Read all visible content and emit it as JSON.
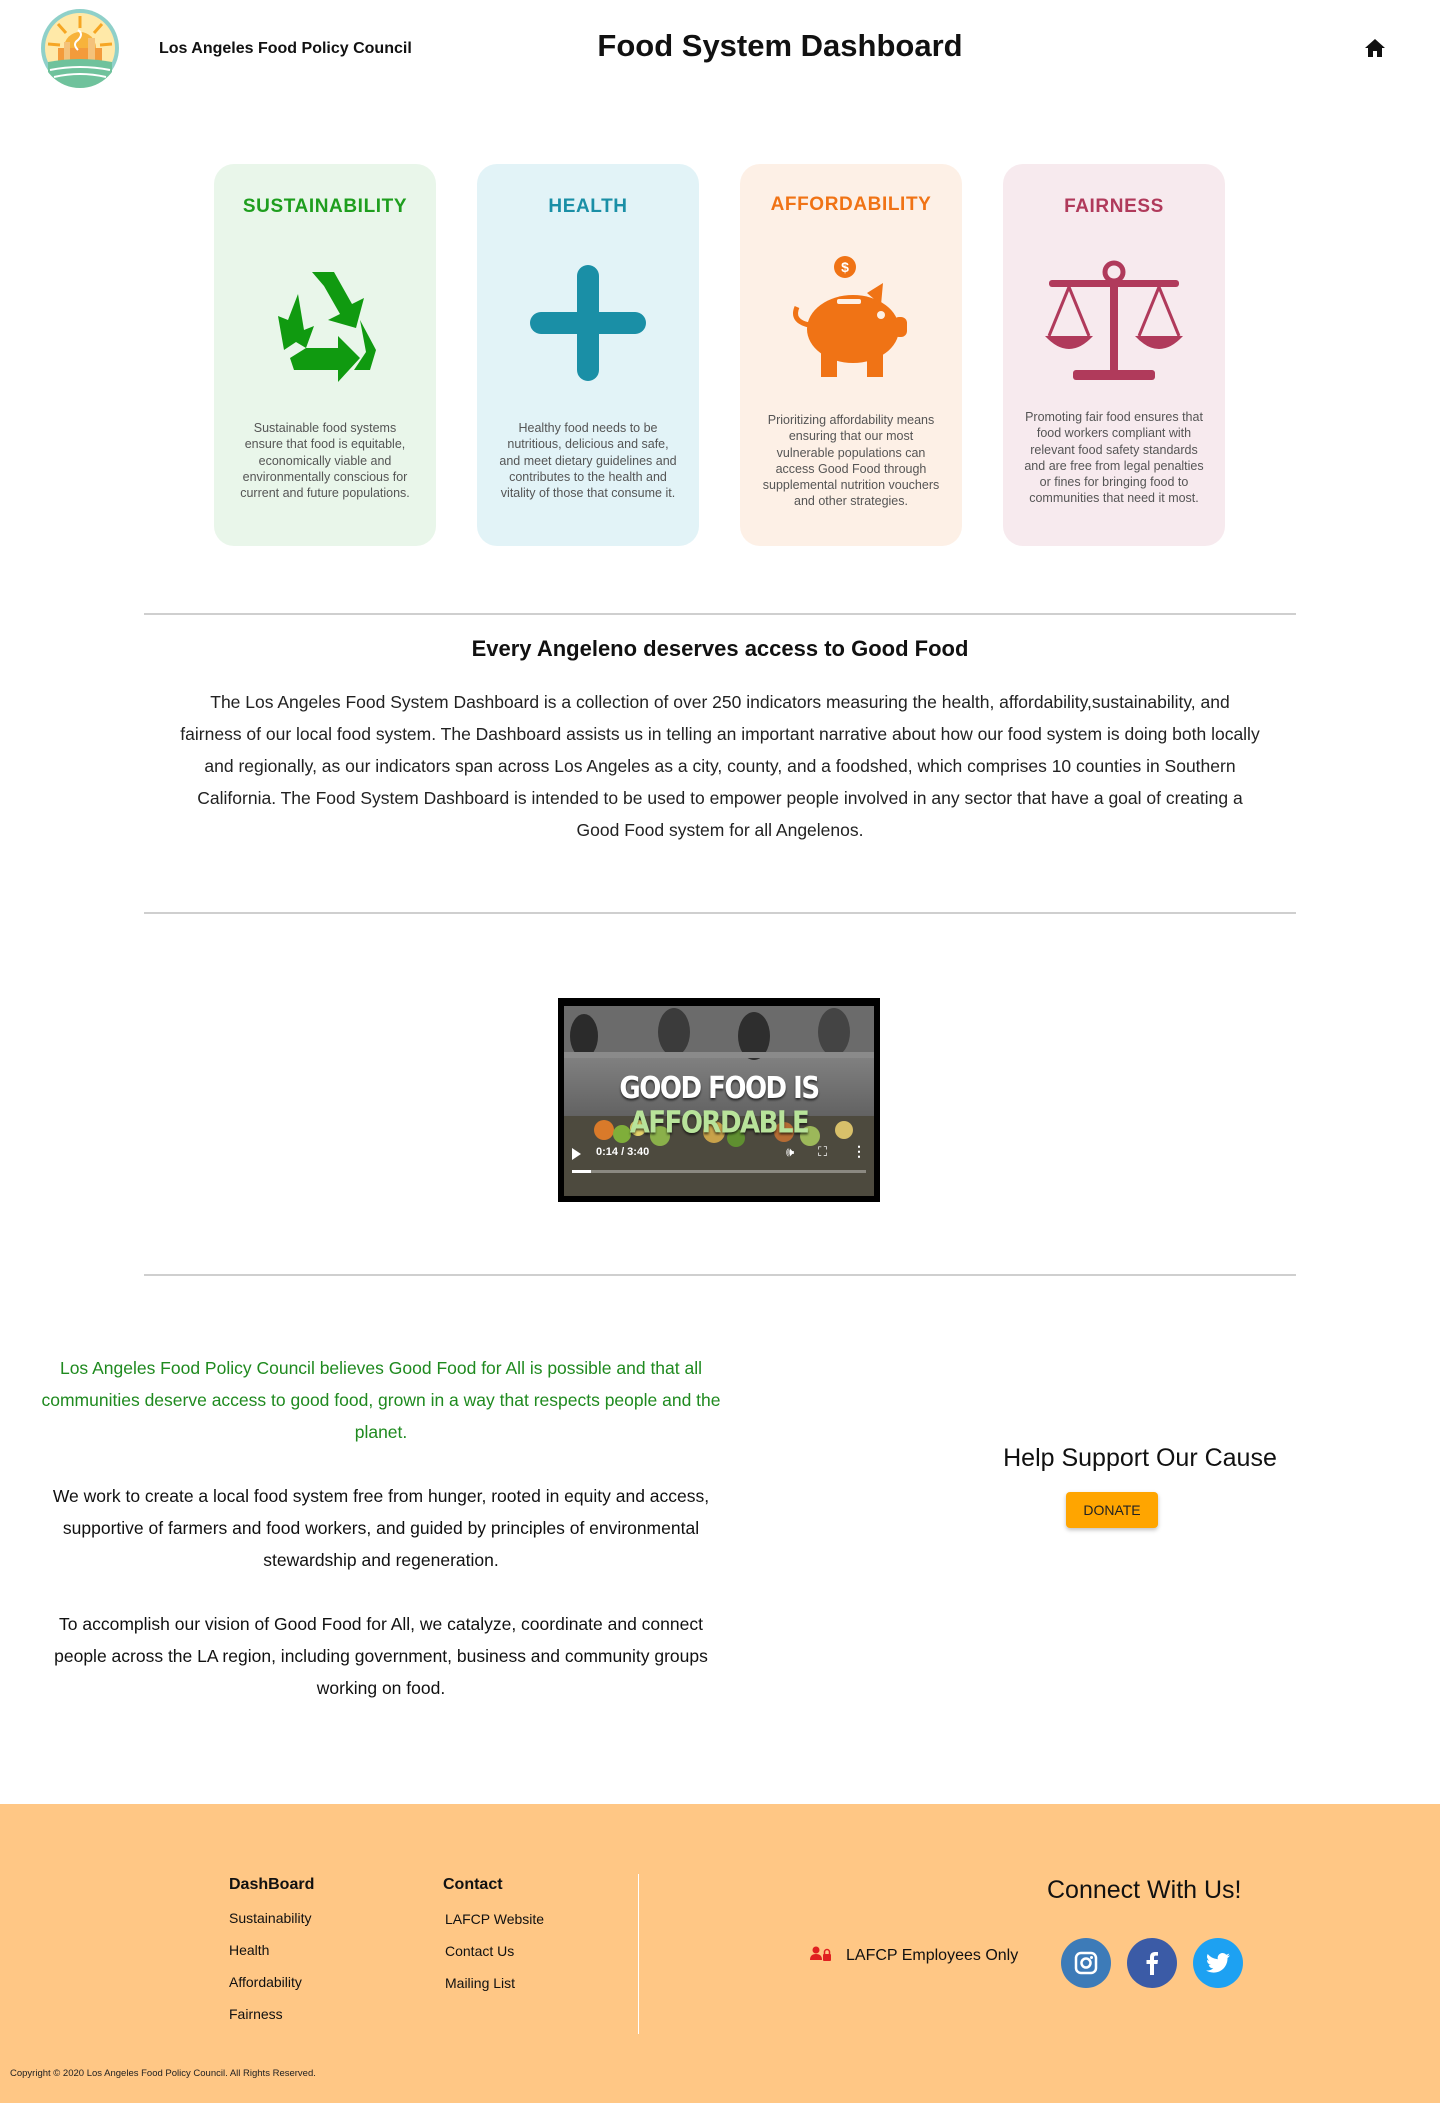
{
  "header": {
    "org_name": "Los Angeles Food Policy Council",
    "title": "Food System Dashboard",
    "logo_icon": "lafpc-sun-logo",
    "home_icon": "home-icon"
  },
  "cards": [
    {
      "title": "SUSTAINABILITY",
      "icon": "recycle-icon",
      "color": "#1e9e1e",
      "background": "#e9f6ea",
      "description": "Sustainable food systems ensure that food is equitable, economically viable and environmentally conscious for current and future populations."
    },
    {
      "title": "HEALTH",
      "icon": "plus-icon",
      "color": "#1a8fa6",
      "background": "#e2f3f7",
      "description": "Healthy food needs to be nutritious, delicious and safe, and meet dietary guidelines and contributes to the health and vitality of those that consume it."
    },
    {
      "title": "AFFORDABILITY",
      "icon": "piggy-bank-icon",
      "color": "#f07315",
      "background": "#fdf0e6",
      "description": "Prioritizing affordability means ensuring that our most vulnerable populations can access Good Food through supplemental nutrition vouchers and other strategies."
    },
    {
      "title": "FAIRNESS",
      "icon": "scales-icon",
      "color": "#b03a5b",
      "background": "#f7eaee",
      "description": "Promoting fair food ensures that food workers compliant with relevant food safety standards and are free from legal penalties or fines for bringing food to communities that need it most."
    }
  ],
  "intro": {
    "title": "Every Angeleno deserves access to Good Food",
    "body": "The Los Angeles Food System Dashboard is a collection of over 250 indicators measuring the health, affordability,sustainability, and fairness of our local food system. The Dashboard assists us in telling an important narrative about how our food system is doing both locally and regionally, as our indicators span across Los Angeles as a city, county, and a foodshed, which comprises 10 counties in Southern California. The Food System Dashboard is intended to be used to empower people involved in any sector that have a goal of creating a Good Food system for all Angelenos."
  },
  "video": {
    "caption_main": "GOOD FOOD IS ",
    "caption_accent": "AFFORDABLE",
    "time": "0:14 / 3:40",
    "progress": 0.064
  },
  "about": {
    "mission": "Los Angeles Food Policy Council believes Good Food for All is possible and that all communities deserve access to good food, grown in a way that respects people and the planet.",
    "work": "We work to create a local food system free from hunger, rooted in equity and access, supportive of farmers and food workers, and guided by principles of environmental stewardship and regeneration.",
    "vision": "To accomplish our vision of Good Food for All, we catalyze, coordinate and connect people across the LA region, including government, business and community groups working on food."
  },
  "support": {
    "title": "Help Support Our Cause",
    "donate_label": "DONATE"
  },
  "footer": {
    "dashboard_heading": "DashBoard",
    "dashboard_links": [
      "Sustainability",
      "Health",
      "Affordability",
      "Fairness"
    ],
    "contact_heading": "Contact",
    "contact_links": [
      "LAFCP Website",
      "Contact Us",
      "Mailing List"
    ],
    "connect_title": "Connect With Us!",
    "employees_label": "LAFCP Employees Only",
    "social": [
      {
        "name": "instagram-icon",
        "color": "#3d7bb8"
      },
      {
        "name": "facebook-icon",
        "color": "#3b5ba6"
      },
      {
        "name": "twitter-icon",
        "color": "#1da1f2"
      }
    ],
    "copyright": "Copyright © 2020 Los Angeles Food Policy Council. All Rights Reserved."
  }
}
